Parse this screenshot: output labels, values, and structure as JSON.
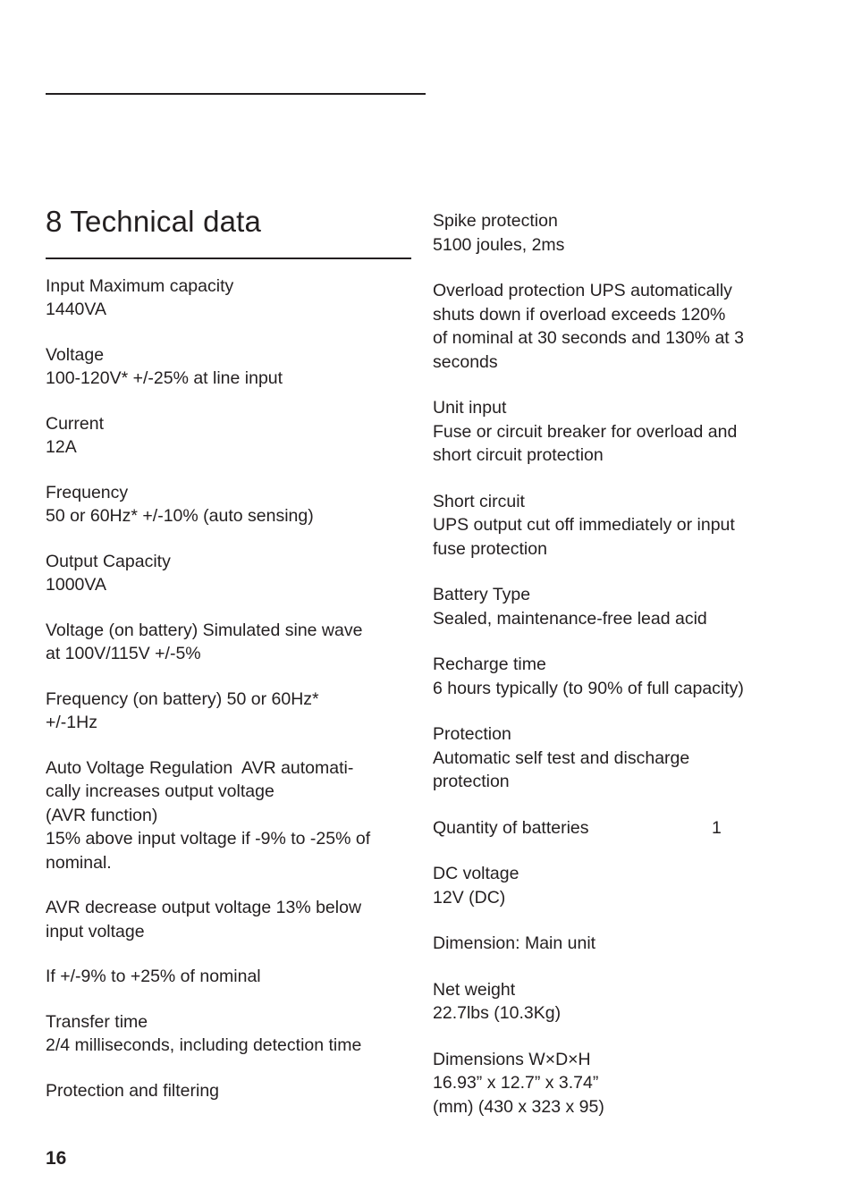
{
  "page": {
    "number": "16",
    "title": "8 Technical data"
  },
  "left_column": [
    {
      "name": "input-maximum-capacity",
      "lines": [
        "Input Maximum capacity",
        "1440VA"
      ]
    },
    {
      "name": "voltage",
      "lines": [
        "Voltage",
        "100-120V* +/-25% at line input"
      ]
    },
    {
      "name": "current",
      "lines": [
        "Current",
        "12A"
      ]
    },
    {
      "name": "frequency",
      "lines": [
        "Frequency",
        "50 or 60Hz* +/-10% (auto sensing)"
      ]
    },
    {
      "name": "output-capacity",
      "lines": [
        "Output Capacity",
        "1000VA"
      ]
    },
    {
      "name": "voltage-on-battery",
      "lines": [
        "Voltage (on battery) Simulated sine wave",
        "at 100V/115V +/-5%"
      ]
    },
    {
      "name": "frequency-on-battery",
      "lines": [
        "Frequency (on battery) 50 or 60Hz*",
        "+/-1Hz"
      ]
    },
    {
      "name": "auto-voltage-regulation",
      "lines": [
        "Auto Voltage Regulation  AVR automati-",
        "cally increases output voltage",
        "(AVR function)",
        "15% above input voltage if -9% to -25% of",
        "nominal."
      ]
    },
    {
      "name": "avr-decrease",
      "lines": [
        "AVR decrease output voltage 13% below",
        "input voltage"
      ]
    },
    {
      "name": "nominal-range",
      "lines": [
        "If +/-9% to +25% of nominal"
      ]
    },
    {
      "name": "transfer-time",
      "lines": [
        "Transfer time",
        "2/4 milliseconds, including detection time"
      ]
    },
    {
      "name": "protection-and-filtering",
      "lines": [
        "Protection and filtering"
      ]
    }
  ],
  "right_column": [
    {
      "name": "spike-protection",
      "lines": [
        "Spike protection",
        "5100 joules, 2ms"
      ]
    },
    {
      "name": "overload-protection",
      "lines": [
        "Overload protection UPS automatically",
        "shuts down if overload exceeds 120%",
        "of nominal at 30 seconds and 130% at 3",
        "seconds"
      ]
    },
    {
      "name": "unit-input",
      "lines": [
        "Unit input",
        "Fuse or circuit breaker for overload and",
        "short circuit protection"
      ]
    },
    {
      "name": "short-circuit",
      "lines": [
        "Short circuit",
        "UPS output cut off immediately or input",
        "fuse protection"
      ]
    },
    {
      "name": "battery-type",
      "lines": [
        "Battery Type",
        "Sealed, maintenance-free lead acid"
      ]
    },
    {
      "name": "recharge-time",
      "lines": [
        "Recharge time",
        "6 hours typically (to 90% of full capacity)"
      ]
    },
    {
      "name": "protection",
      "lines": [
        "Protection",
        "Automatic self test and discharge",
        "protection"
      ]
    }
  ],
  "quantity_row": {
    "label": "Quantity of batteries",
    "value": "1"
  },
  "right_column_tail": [
    {
      "name": "dc-voltage",
      "lines": [
        "DC voltage",
        "12V (DC)"
      ]
    },
    {
      "name": "dimension-main-unit",
      "lines": [
        "Dimension: Main unit"
      ]
    },
    {
      "name": "net-weight",
      "lines": [
        "Net weight",
        "22.7lbs (10.3Kg)"
      ]
    },
    {
      "name": "dimensions-wxdxh",
      "lines": [
        "Dimensions W×D×H",
        "16.93” x 12.7” x 3.74”",
        "(mm) (430 x 323 x 95)"
      ]
    }
  ]
}
